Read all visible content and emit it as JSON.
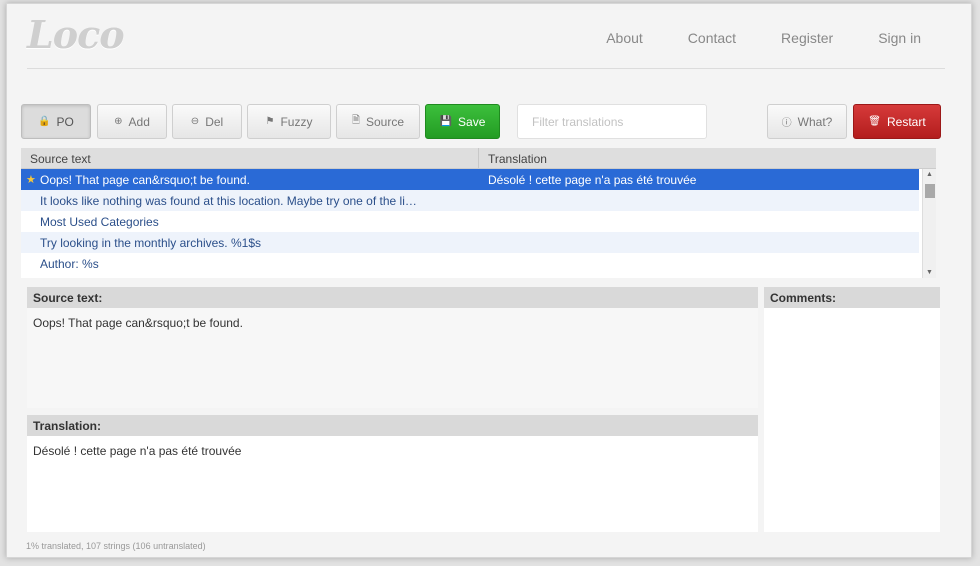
{
  "app": {
    "logo": "Loco"
  },
  "nav": [
    "About",
    "Contact",
    "Register",
    "Sign in"
  ],
  "toolbar": {
    "po": "PO",
    "add": "Add",
    "del": "Del",
    "fuzzy": "Fuzzy",
    "source": "Source",
    "save": "Save",
    "filter_placeholder": "Filter translations",
    "what": "What?",
    "restart": "Restart"
  },
  "icons": {
    "po": "lock-icon",
    "add": "plus-circle-icon",
    "del": "minus-circle-icon",
    "fuzzy": "flag-icon",
    "source": "document-icon",
    "save": "floppy-icon",
    "what": "info-icon",
    "restart": "trash-icon",
    "row_star": "star-icon"
  },
  "grid": {
    "headers": {
      "source": "Source text",
      "translation": "Translation"
    },
    "rows": [
      {
        "source": "Oops! That page can&rsquo;t be found.",
        "translation": "Désolé ! cette page n'a pas été trouvée",
        "selected": true
      },
      {
        "source": "It looks like nothing was found at this location. Maybe try one of the li…",
        "translation": ""
      },
      {
        "source": "Most Used Categories",
        "translation": ""
      },
      {
        "source": "Try looking in the monthly archives. %1$s",
        "translation": ""
      },
      {
        "source": "Author: %s",
        "translation": ""
      }
    ]
  },
  "editor": {
    "source_label": "Source text:",
    "source_text": "Oops! That page can&rsquo;t be found.",
    "translation_label": "Translation:",
    "translation_text": "Désolé ! cette page n'a pas été trouvée",
    "comments_label": "Comments:"
  },
  "status": "1% translated, 107 strings (106 untranslated)",
  "colors": {
    "accent": "#2a6ad6",
    "save": "#2ea62e",
    "restart": "#c42222"
  }
}
